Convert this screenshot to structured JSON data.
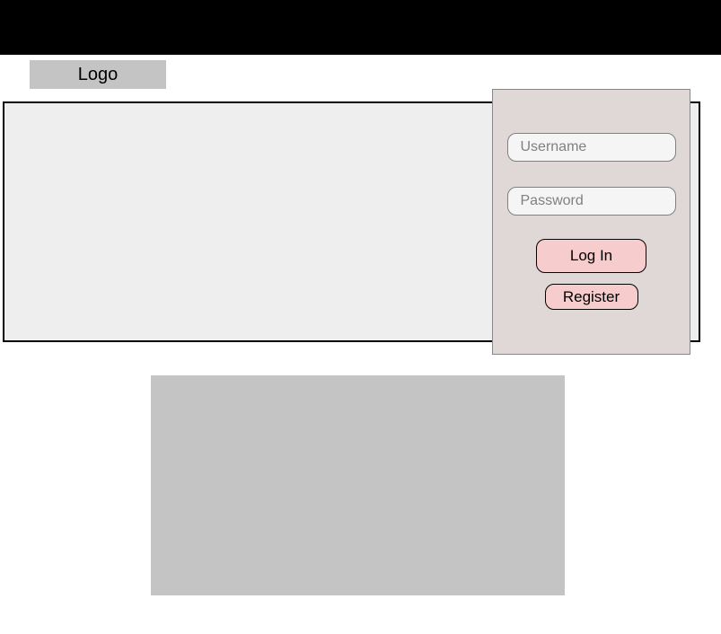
{
  "header": {
    "logo_label": "Logo"
  },
  "login_panel": {
    "username_placeholder": "Username",
    "password_placeholder": "Password",
    "login_label": "Log In",
    "register_label": "Register"
  },
  "colors": {
    "top_bar": "#000000",
    "logo_bg": "#c4c4c4",
    "hero_bg": "#eeeeee",
    "login_panel_bg": "#e0d7d7",
    "button_bg": "#f6cccc",
    "content_image_bg": "#c4c4c4"
  }
}
